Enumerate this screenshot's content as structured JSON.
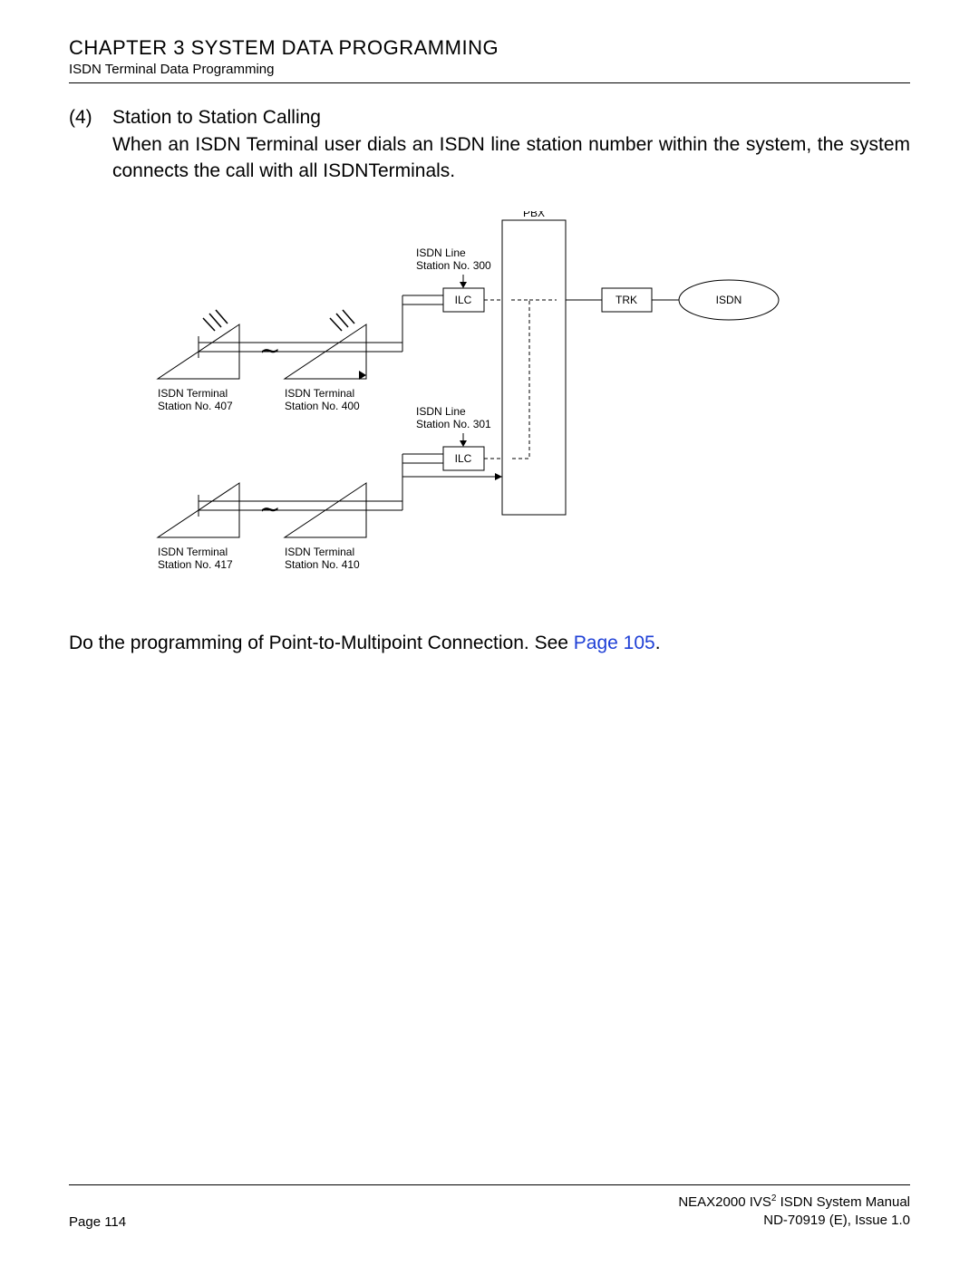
{
  "header": {
    "chapter": "CHAPTER 3  SYSTEM DATA PROGRAMMING",
    "subtitle": "ISDN Terminal Data Programming"
  },
  "section": {
    "number": "(4)",
    "title": "Station to Station Calling",
    "paragraph": "When an ISDN Terminal user dials an ISDN line station number within the system, the system connects the call with all ISDNTerminals."
  },
  "diagram": {
    "pbx": "PBX",
    "trk": "TRK",
    "isdn": "ISDN",
    "ilc1_line1": "ISDN Line",
    "ilc1_line2": "Station No. 300",
    "ilc1_box": "ILC",
    "ilc2_line1": "ISDN Line",
    "ilc2_line2": "Station No. 301",
    "ilc2_box": "ILC",
    "term1_line1": "ISDN Terminal",
    "term1_line2": "Station No. 407",
    "term2_line1": "ISDN Terminal",
    "term2_line2": "Station No. 400",
    "term3_line1": "ISDN Terminal",
    "term3_line2": "Station No. 417",
    "term4_line1": "ISDN Terminal",
    "term4_line2": "Station No. 410"
  },
  "post": {
    "text_before": "Do the programming of Point-to-Multipoint Connection. See ",
    "link_text": "Page 105",
    "text_after": "."
  },
  "footer": {
    "page": "Page 114",
    "manual_pre": "NEAX2000 IVS",
    "manual_sup": "2",
    "manual_post": " ISDN System Manual",
    "docid": "ND-70919 (E), Issue 1.0"
  }
}
